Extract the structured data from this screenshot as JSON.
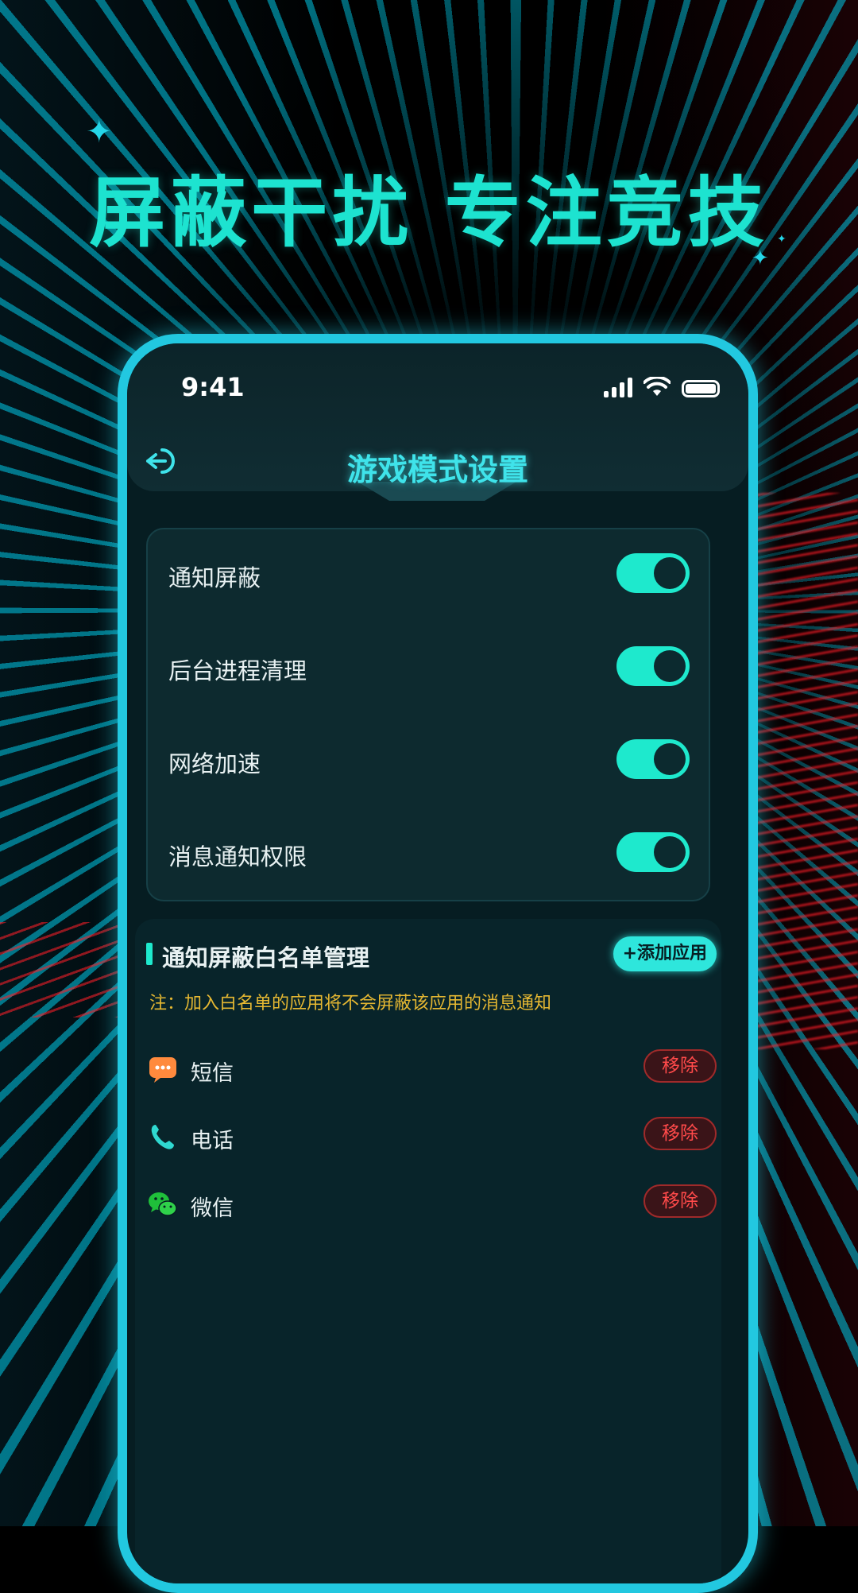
{
  "hero": {
    "headline": "屏蔽干扰  专注竞技"
  },
  "status_bar": {
    "time": "9:41"
  },
  "header": {
    "title": "游戏模式设置"
  },
  "settings": [
    {
      "label": "通知屏蔽",
      "enabled": true
    },
    {
      "label": "后台进程清理",
      "enabled": true
    },
    {
      "label": "网络加速",
      "enabled": true
    },
    {
      "label": "消息通知权限",
      "enabled": true
    }
  ],
  "whitelist": {
    "title": "通知屏蔽白名单管理",
    "add_label": "+添加应用",
    "note": "注：加入白名单的应用将不会屏蔽该应用的消息通知",
    "apps": [
      {
        "name": "短信",
        "icon": "sms-icon",
        "remove_label": "移除"
      },
      {
        "name": "电话",
        "icon": "phone-icon",
        "remove_label": "移除"
      },
      {
        "name": "微信",
        "icon": "wechat-icon",
        "remove_label": "移除"
      }
    ]
  },
  "colors": {
    "accent": "#1ee9cd",
    "frame": "#22c8e0",
    "warning": "#e6b832",
    "danger": "#ff4a4a"
  }
}
